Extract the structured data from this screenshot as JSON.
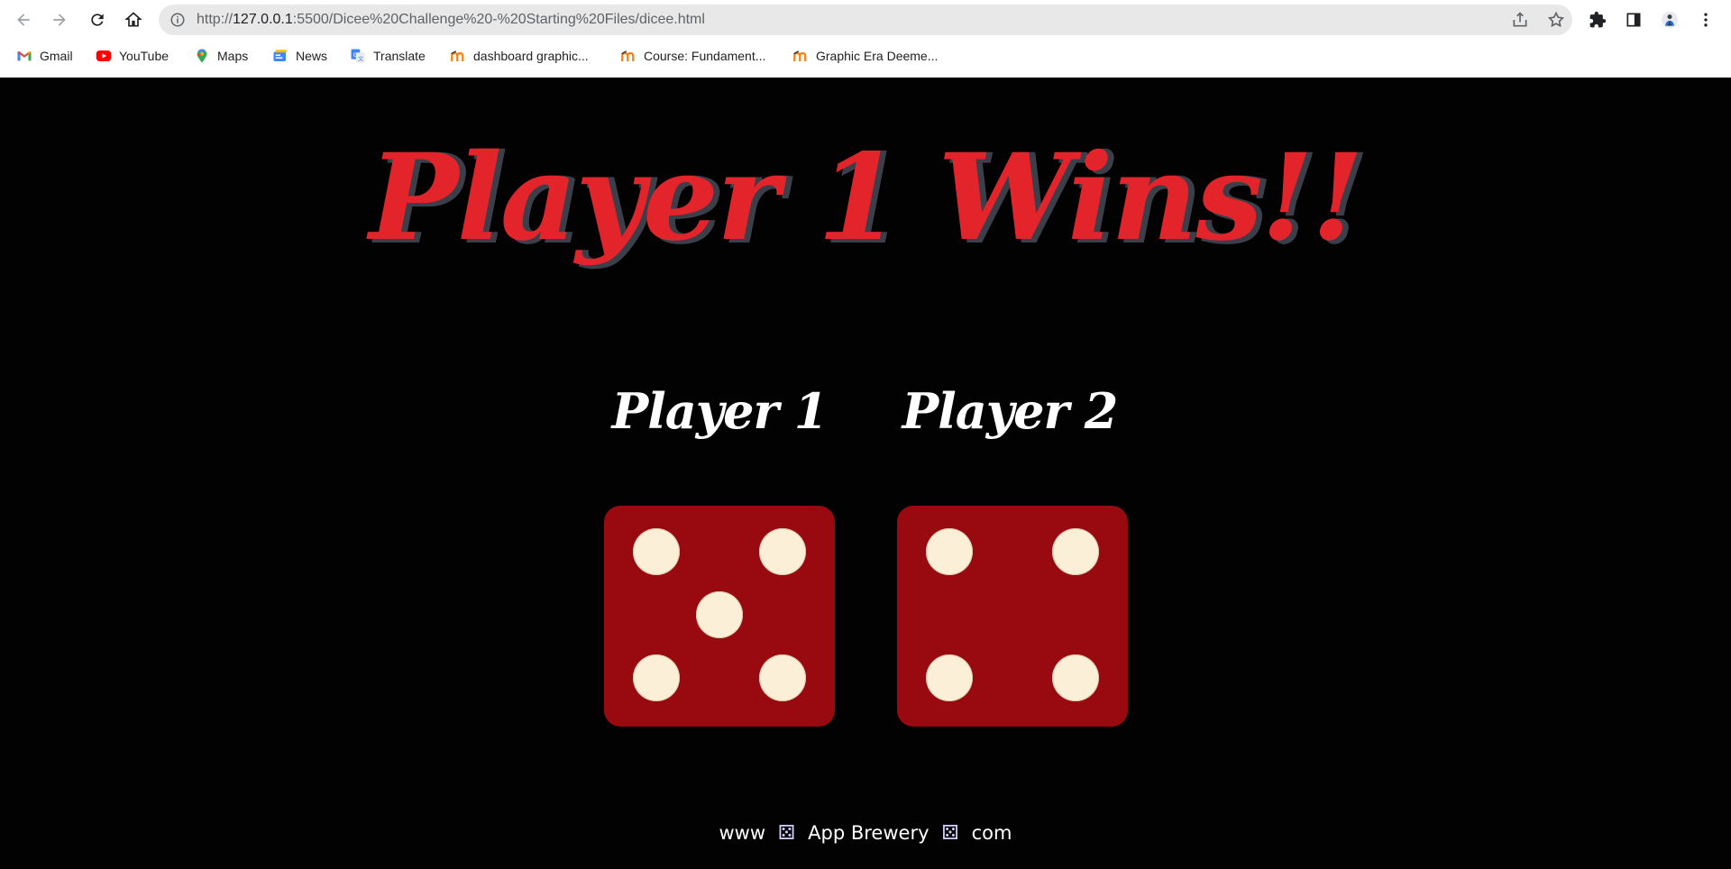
{
  "browser": {
    "url_scheme": "http://",
    "url_host": "127.0.0.1",
    "url_rest": ":5500/Dicee%20Challenge%20-%20Starting%20Files/dicee.html",
    "bookmarks": [
      {
        "label": "Gmail",
        "icon": "gmail-icon"
      },
      {
        "label": "YouTube",
        "icon": "youtube-icon"
      },
      {
        "label": "Maps",
        "icon": "maps-icon"
      },
      {
        "label": "News",
        "icon": "news-icon"
      },
      {
        "label": "Translate",
        "icon": "translate-icon"
      },
      {
        "label": "dashboard graphic...",
        "icon": "moodle-icon"
      },
      {
        "label": "Course: Fundament...",
        "icon": "moodle-icon"
      },
      {
        "label": "Graphic Era Deeme...",
        "icon": "moodle-icon"
      }
    ]
  },
  "game": {
    "headline": "Player 1 Wins!!",
    "headline_color": "#e3242b",
    "players": [
      {
        "label": "Player 1",
        "die_value": 5
      },
      {
        "label": "Player 2",
        "die_value": 4
      }
    ],
    "die_color": "#990a10",
    "pip_color": "#fbefd8"
  },
  "footer": {
    "prefix": "www",
    "brand": "App Brewery",
    "suffix": "com"
  }
}
